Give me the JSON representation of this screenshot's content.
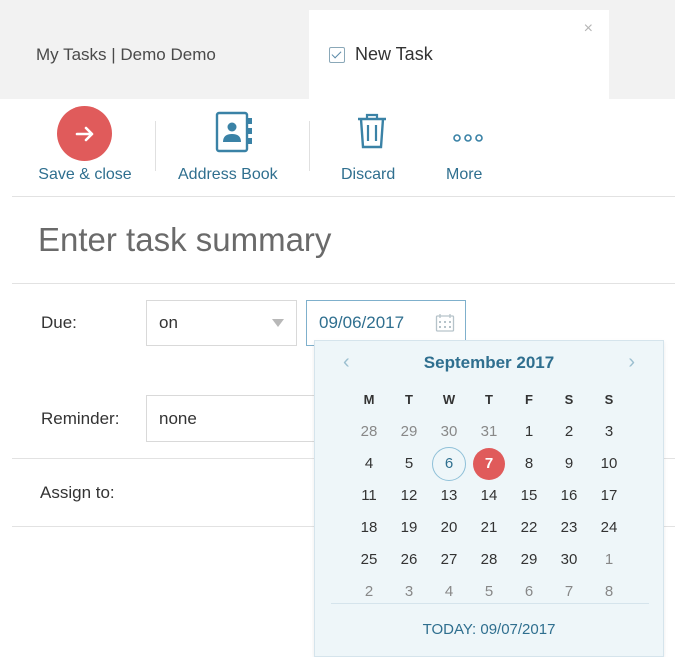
{
  "tabs": {
    "my_tasks": "My Tasks | Demo Demo",
    "new_task": "New Task",
    "close_glyph": "×"
  },
  "toolbar": {
    "save_close": "Save & close",
    "address_book": "Address Book",
    "discard": "Discard",
    "more": "More"
  },
  "summary": {
    "placeholder": "Enter task summary"
  },
  "form": {
    "due_label": "Due:",
    "due_mode": "on",
    "due_date": "09/06/2017",
    "reminder_label": "Reminder:",
    "reminder_value": "none",
    "assign_label": "Assign to:"
  },
  "calendar": {
    "month_title": "September 2017",
    "prev": "‹",
    "next": "›",
    "weekdays": [
      "M",
      "T",
      "W",
      "T",
      "F",
      "S",
      "S"
    ],
    "weeks": [
      [
        "28",
        "29",
        "30",
        "31",
        "1",
        "2",
        "3"
      ],
      [
        "4",
        "5",
        "6",
        "7",
        "8",
        "9",
        "10"
      ],
      [
        "11",
        "12",
        "13",
        "14",
        "15",
        "16",
        "17"
      ],
      [
        "18",
        "19",
        "20",
        "21",
        "22",
        "23",
        "24"
      ],
      [
        "25",
        "26",
        "27",
        "28",
        "29",
        "30",
        "1"
      ],
      [
        "2",
        "3",
        "4",
        "5",
        "6",
        "7",
        "8"
      ]
    ],
    "selected_day": "6",
    "today_day": "7",
    "today_label": "TODAY: 09/07/2017"
  },
  "colors": {
    "accent": "#2f6f8f",
    "save_red": "#e05b5b",
    "calendar_bg": "#eef6f9"
  }
}
